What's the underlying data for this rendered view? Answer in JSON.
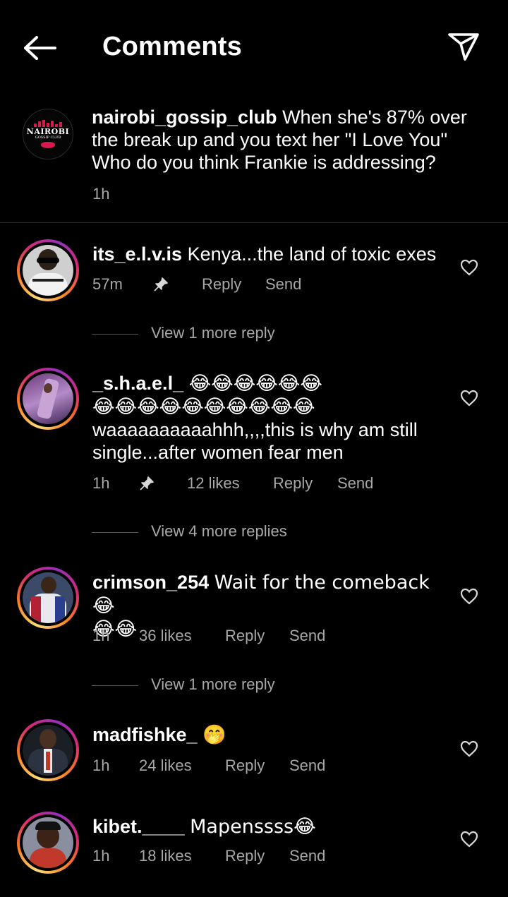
{
  "header": {
    "title": "Comments"
  },
  "caption": {
    "username": "nairobi_gossip_club",
    "text": "When she's 87% over the break up and you text her \"I  Love You\" Who do you think Frankie is addressing?",
    "time": "1h",
    "logo": {
      "line1": "NAIROBI",
      "line2": "GOSSIP CLUB"
    }
  },
  "comments": [
    {
      "username": "its_e.l.v.is",
      "text": "Kenya...the land of toxic exes",
      "time": "57m",
      "likes": "",
      "reply_label": "Reply",
      "send_label": "Send",
      "more_replies": "View 1 more reply"
    },
    {
      "username": "_s.h.a.e.l_",
      "emoji_line1": "😂😂😂😂😂😂",
      "emoji_line2": "😂😂😂😂😂😂😂😂😂😂",
      "text": "waaaaaaaaaahhh,,,,this is why am still single...after women fear men",
      "time": "1h",
      "likes": "12 likes",
      "reply_label": "Reply",
      "send_label": "Send",
      "more_replies": "View 4 more replies"
    },
    {
      "username": "crimson_254",
      "text": "Wait for the comeback 😂",
      "emoji_line2": "😂😂",
      "time": "1h",
      "likes": "36 likes",
      "reply_label": "Reply",
      "send_label": "Send",
      "more_replies": "View 1 more reply"
    },
    {
      "username": "madfishke_",
      "text": "🤭",
      "time": "1h",
      "likes": "24 likes",
      "reply_label": "Reply",
      "send_label": "Send"
    },
    {
      "username": "kibet.____",
      "text": "Mapenssss😂",
      "time": "1h",
      "likes": "18 likes",
      "reply_label": "Reply",
      "send_label": "Send"
    }
  ],
  "icons": {
    "back": "arrow-left-icon",
    "send": "paper-plane-icon",
    "pin": "pin-icon",
    "like": "heart-outline-icon"
  }
}
